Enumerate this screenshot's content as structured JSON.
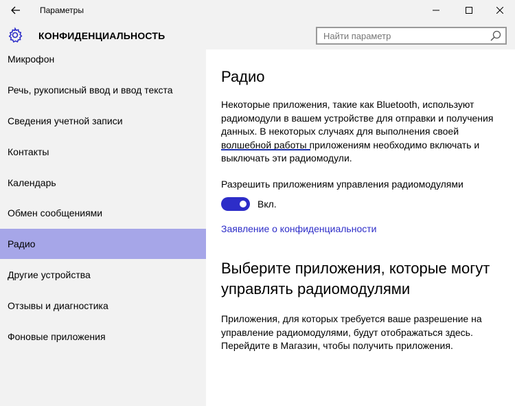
{
  "window": {
    "title": "Параметры"
  },
  "header": {
    "section_title": "КОНФИДЕНЦИАЛЬНОСТЬ",
    "search_placeholder": "Найти параметр"
  },
  "sidebar": {
    "items": [
      {
        "label": "Микрофон"
      },
      {
        "label": "Речь, рукописный ввод и ввод текста"
      },
      {
        "label": "Сведения учетной записи"
      },
      {
        "label": "Контакты"
      },
      {
        "label": "Календарь"
      },
      {
        "label": "Обмен сообщениями"
      },
      {
        "label": "Радио",
        "selected": true
      },
      {
        "label": "Другие устройства"
      },
      {
        "label": "Отзывы и диагностика"
      },
      {
        "label": "Фоновые приложения"
      }
    ]
  },
  "main": {
    "title": "Радио",
    "description": "Некоторые приложения, такие как Bluetooth, используют радиомодули в вашем устройстве для отправки и получения данных. В некоторых случаях для выполнения своей волшебной работы приложениям необходимо включать и выключать эти радиомодули.",
    "toggle_label": "Разрешить приложениям управления радиомодулями",
    "toggle_on": true,
    "toggle_state": "Вкл.",
    "privacy_link": "Заявление о конфиденциальности",
    "apps_heading": "Выберите приложения, которые могут управлять радиомодулями",
    "apps_description": "Приложения, для которых требуется ваше разрешение на управление радиомодулями, будут отображаться здесь. Перейдите в Магазин, чтобы получить приложения."
  },
  "colors": {
    "accent": "#2d2dc8",
    "selected_bg": "#a6a6e8",
    "sidebar_bg": "#f2f2f2"
  },
  "icons": [
    "back-arrow-icon",
    "minimize-icon",
    "maximize-icon",
    "close-icon",
    "gear-icon",
    "search-icon"
  ]
}
